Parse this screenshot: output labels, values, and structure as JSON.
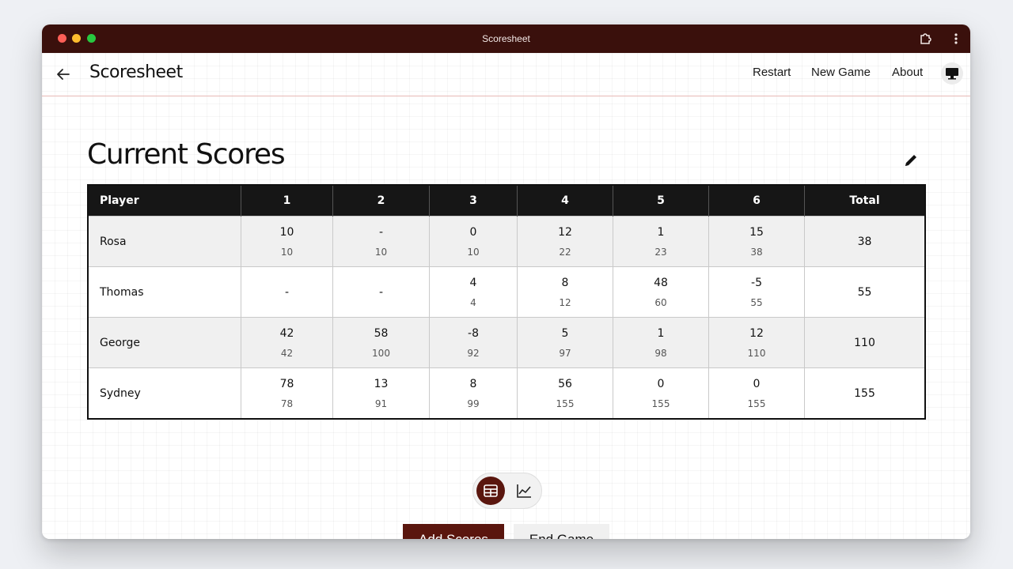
{
  "window": {
    "title": "Scoresheet"
  },
  "header": {
    "title": "Scoresheet",
    "nav": {
      "restart": "Restart",
      "new_game": "New Game",
      "about": "About"
    }
  },
  "main": {
    "title": "Current Scores",
    "table": {
      "headers": [
        "Player",
        "1",
        "2",
        "3",
        "4",
        "5",
        "6",
        "Total"
      ],
      "rows": [
        {
          "player": "Rosa",
          "rounds": [
            {
              "score": "10",
              "cumulative": "10"
            },
            {
              "score": "-",
              "cumulative": "10"
            },
            {
              "score": "0",
              "cumulative": "10"
            },
            {
              "score": "12",
              "cumulative": "22"
            },
            {
              "score": "1",
              "cumulative": "23"
            },
            {
              "score": "15",
              "cumulative": "38"
            }
          ],
          "total": "38"
        },
        {
          "player": "Thomas",
          "rounds": [
            {
              "score": "-",
              "cumulative": ""
            },
            {
              "score": "-",
              "cumulative": ""
            },
            {
              "score": "4",
              "cumulative": "4"
            },
            {
              "score": "8",
              "cumulative": "12"
            },
            {
              "score": "48",
              "cumulative": "60"
            },
            {
              "score": "-5",
              "cumulative": "55"
            }
          ],
          "total": "55"
        },
        {
          "player": "George",
          "rounds": [
            {
              "score": "42",
              "cumulative": "42"
            },
            {
              "score": "58",
              "cumulative": "100"
            },
            {
              "score": "-8",
              "cumulative": "92"
            },
            {
              "score": "5",
              "cumulative": "97"
            },
            {
              "score": "1",
              "cumulative": "98"
            },
            {
              "score": "12",
              "cumulative": "110"
            }
          ],
          "total": "110"
        },
        {
          "player": "Sydney",
          "rounds": [
            {
              "score": "78",
              "cumulative": "78"
            },
            {
              "score": "13",
              "cumulative": "91"
            },
            {
              "score": "8",
              "cumulative": "99"
            },
            {
              "score": "56",
              "cumulative": "155"
            },
            {
              "score": "0",
              "cumulative": "155"
            },
            {
              "score": "0",
              "cumulative": "155"
            }
          ],
          "total": "155"
        }
      ]
    }
  },
  "footer": {
    "view_toggle": {
      "active": "table",
      "options": [
        "table-icon",
        "chart-icon"
      ]
    },
    "add_scores": "Add Scores",
    "end_game": "End Game"
  },
  "colors": {
    "titlebar": "#3a100c",
    "accent": "#5a160e",
    "table_header": "#161616",
    "divider": "#e8b9b5"
  },
  "icons": [
    "back-arrow-icon",
    "puzzle-extension-icon",
    "kebab-menu-icon",
    "monitor-icon",
    "pencil-edit-icon",
    "table-icon",
    "chart-icon"
  ]
}
